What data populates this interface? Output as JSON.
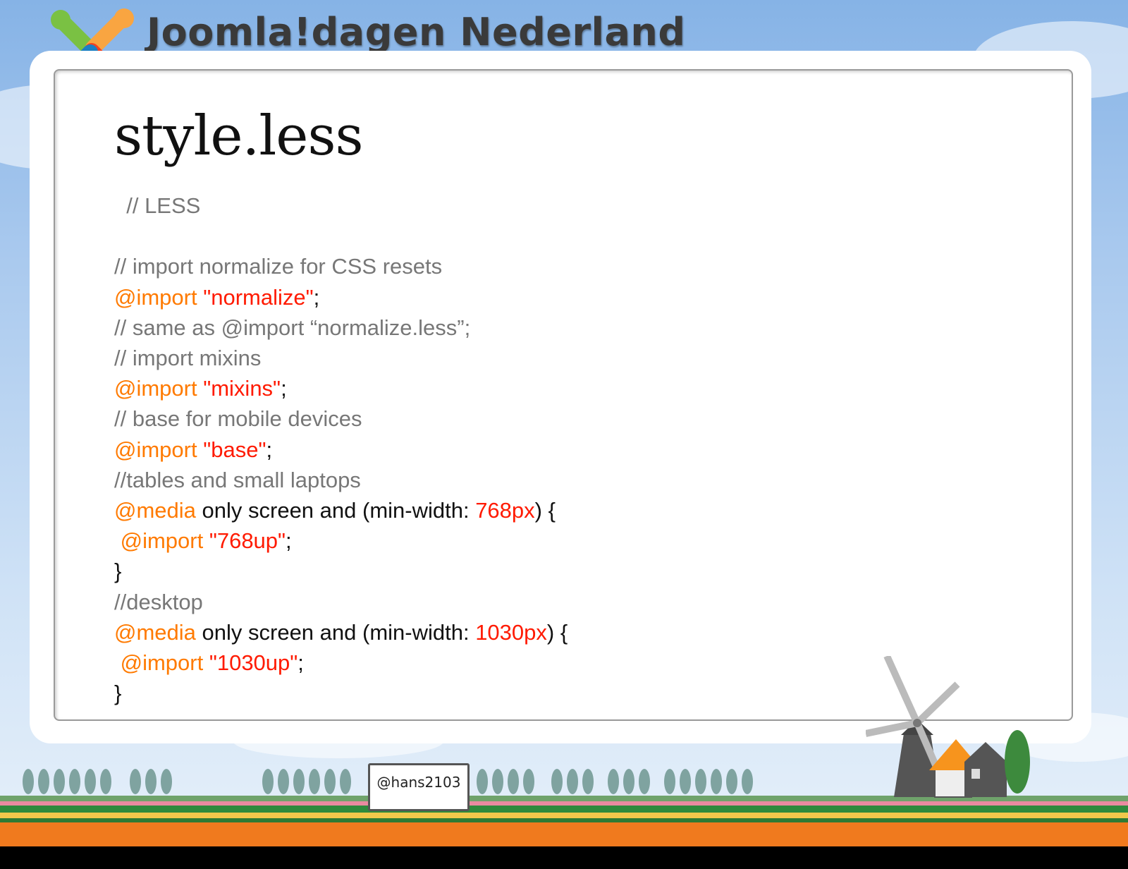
{
  "brand": {
    "name": "Joomla!dagen Nederland"
  },
  "slide": {
    "title": "style.less"
  },
  "code_lines": [
    [
      {
        "t": "  // LESS",
        "c": "cm"
      }
    ],
    [
      {
        "t": "",
        "c": "pl"
      }
    ],
    [
      {
        "t": "// import normalize for CSS resets",
        "c": "cm"
      }
    ],
    [
      {
        "t": "@import ",
        "c": "at"
      },
      {
        "t": "\"normalize\"",
        "c": "str"
      },
      {
        "t": ";",
        "c": "pl"
      }
    ],
    [
      {
        "t": "// same as @import “normalize.less”;",
        "c": "cm"
      }
    ],
    [
      {
        "t": "// import mixins",
        "c": "cm"
      }
    ],
    [
      {
        "t": "@import ",
        "c": "at"
      },
      {
        "t": "\"mixins\"",
        "c": "str"
      },
      {
        "t": ";",
        "c": "pl"
      }
    ],
    [
      {
        "t": "// base for mobile devices",
        "c": "cm"
      }
    ],
    [
      {
        "t": "@import ",
        "c": "at"
      },
      {
        "t": "\"base\"",
        "c": "str"
      },
      {
        "t": ";",
        "c": "pl"
      }
    ],
    [
      {
        "t": "//tables and small laptops",
        "c": "cm"
      }
    ],
    [
      {
        "t": "@media",
        "c": "at"
      },
      {
        "t": " only screen and (min-width: ",
        "c": "pl"
      },
      {
        "t": "768px",
        "c": "num"
      },
      {
        "t": ") {",
        "c": "pl"
      }
    ],
    [
      {
        "t": " @import ",
        "c": "at"
      },
      {
        "t": "\"768up\"",
        "c": "str"
      },
      {
        "t": ";",
        "c": "pl"
      }
    ],
    [
      {
        "t": "}",
        "c": "pl"
      }
    ],
    [
      {
        "t": "//desktop",
        "c": "cm"
      }
    ],
    [
      {
        "t": "@media",
        "c": "at"
      },
      {
        "t": " only screen and (min-width: ",
        "c": "pl"
      },
      {
        "t": "1030px",
        "c": "num"
      },
      {
        "t": ") {",
        "c": "pl"
      }
    ],
    [
      {
        "t": " @import ",
        "c": "at"
      },
      {
        "t": "\"1030up\"",
        "c": "str"
      },
      {
        "t": ";",
        "c": "pl"
      }
    ],
    [
      {
        "t": "}",
        "c": "pl"
      }
    ]
  ],
  "footer": {
    "sign_text": "@hans2103"
  },
  "colors": {
    "comment": "#777777",
    "at_rule": "#ff7a00",
    "string": "#ff1a00",
    "text": "#111111"
  }
}
